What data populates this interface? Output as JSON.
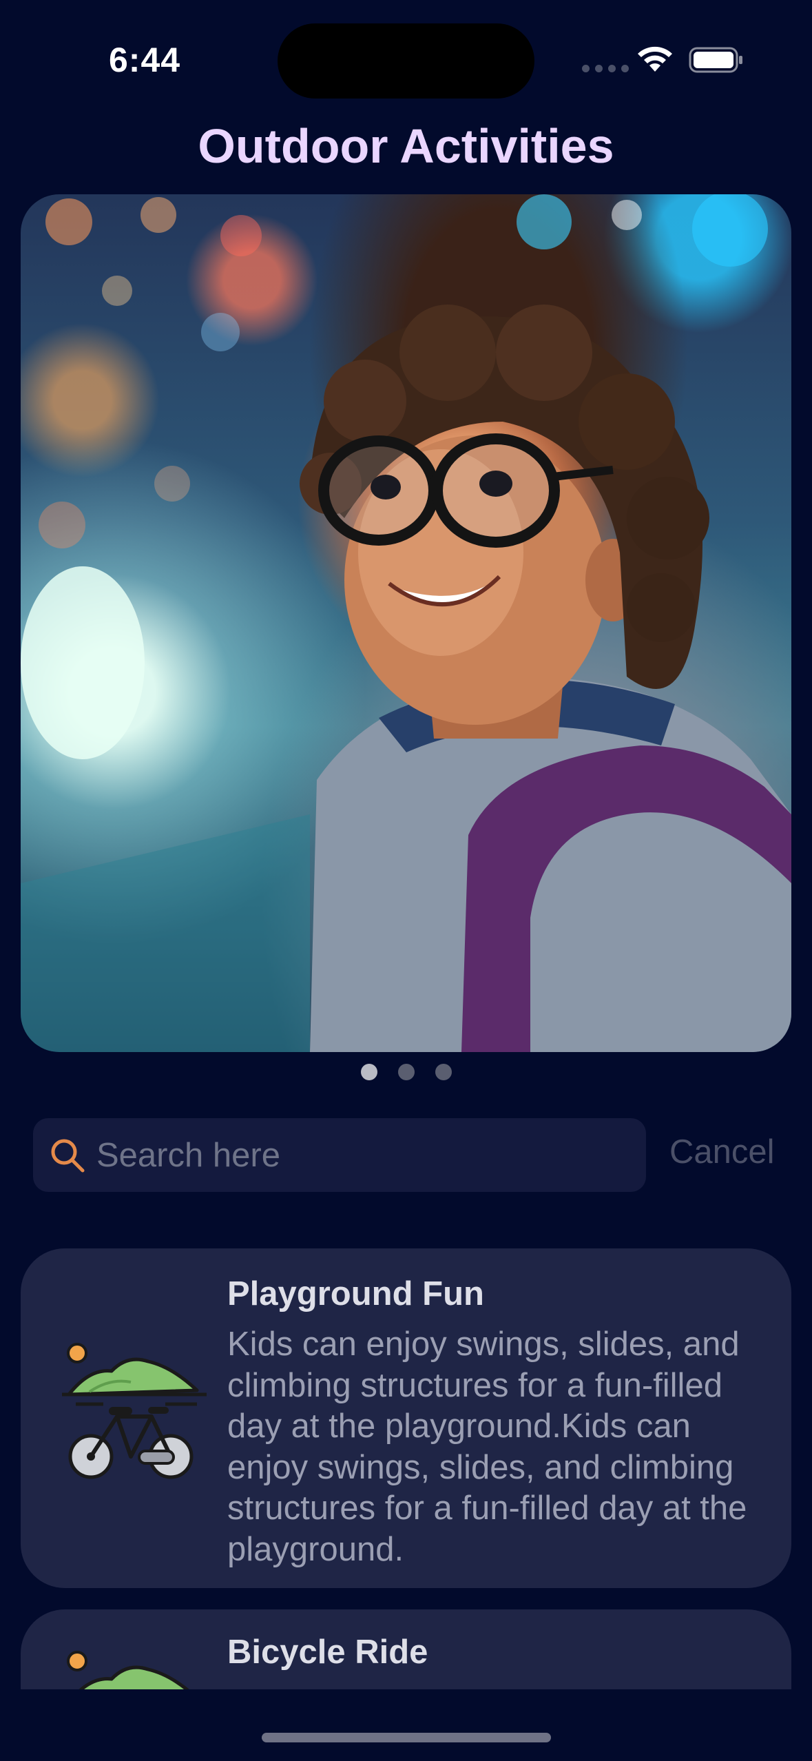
{
  "status_bar": {
    "time": "6:44"
  },
  "header": {
    "title": "Outdoor Activities"
  },
  "hero": {
    "image_icon": "photo-child-with-glasses",
    "page_count": 3,
    "active_page": 1
  },
  "search": {
    "placeholder": "Search here",
    "value": "",
    "cancel_label": "Cancel",
    "icon": "search-icon",
    "icon_color": "#e58a4a"
  },
  "activities": [
    {
      "title": "Playground Fun",
      "description": "Kids can enjoy swings, slides, and climbing structures for a fun-filled day at the playground.Kids can enjoy swings, slides, and climbing structures for a fun-filled day at the playground.",
      "icon": "bicycle-hills-icon"
    },
    {
      "title": "Bicycle Ride",
      "description": "",
      "icon": "bicycle-hills-icon"
    }
  ],
  "colors": {
    "background": "#020a2c",
    "title": "#ead6ff",
    "card": "#1f2546",
    "search_field": "#141a3e"
  }
}
